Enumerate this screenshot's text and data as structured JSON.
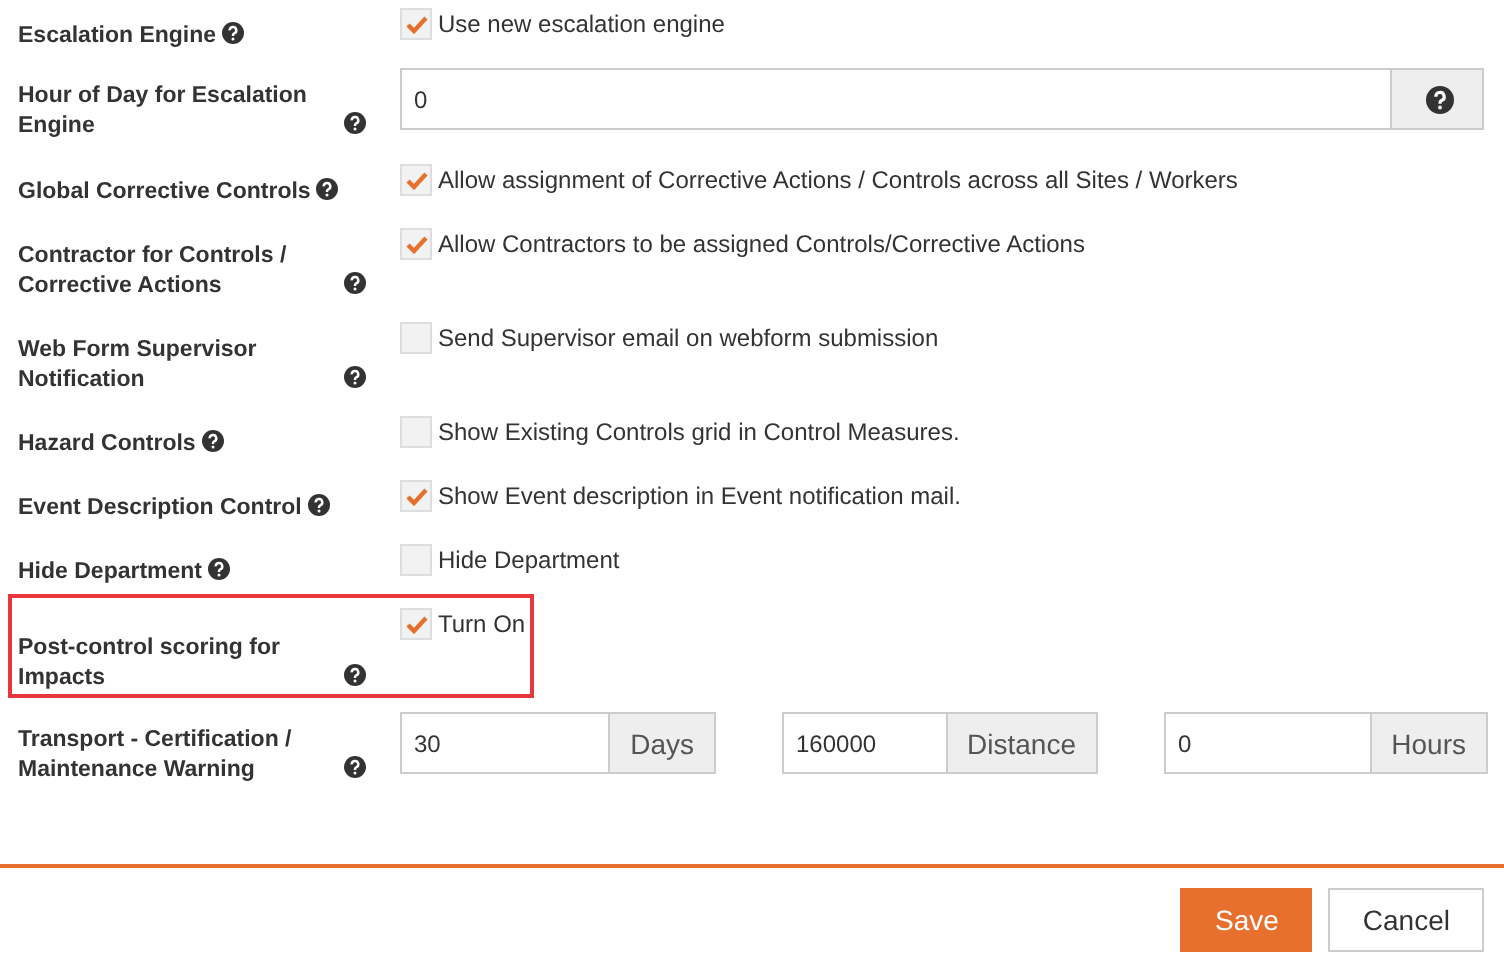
{
  "settings": [
    {
      "kind": "checkbox",
      "label": "Escalation Engine",
      "checked": true,
      "text": "Use new escalation engine",
      "highlighted": false
    },
    {
      "kind": "input",
      "label": "Hour of Day for Escalation Engine",
      "value": "0",
      "highlighted": false
    },
    {
      "kind": "checkbox",
      "label": "Global Corrective Controls",
      "checked": true,
      "text": "Allow assignment of Corrective Actions / Controls across all Sites / Workers",
      "highlighted": false
    },
    {
      "kind": "checkbox",
      "label": "Contractor for Controls / Corrective Actions",
      "checked": true,
      "text": "Allow Contractors to be assigned Controls/Corrective Actions",
      "highlighted": false
    },
    {
      "kind": "checkbox",
      "label": "Web Form Supervisor Notification",
      "checked": false,
      "text": "Send Supervisor email on webform submission",
      "highlighted": false
    },
    {
      "kind": "checkbox",
      "label": "Hazard Controls",
      "checked": false,
      "text": "Show Existing Controls grid in Control Measures.",
      "highlighted": false
    },
    {
      "kind": "checkbox",
      "label": "Event Description Control",
      "checked": true,
      "text": "Show Event description in Event notification mail.",
      "highlighted": false
    },
    {
      "kind": "checkbox",
      "label": "Hide Department",
      "checked": false,
      "text": "Hide Department",
      "highlighted": false
    },
    {
      "kind": "checkbox",
      "label": "Post-control scoring for Impacts",
      "checked": true,
      "text": "Turn On",
      "highlighted": true
    },
    {
      "kind": "triple",
      "label": "Transport - Certification / Maintenance Warning",
      "highlighted": false,
      "fields": [
        {
          "value": "30",
          "unit": "Days"
        },
        {
          "value": "160000",
          "unit": "Distance"
        },
        {
          "value": "0",
          "unit": "Hours"
        }
      ]
    }
  ],
  "buttons": [
    {
      "label": "Save",
      "primary": true
    },
    {
      "label": "Cancel",
      "primary": false
    }
  ]
}
